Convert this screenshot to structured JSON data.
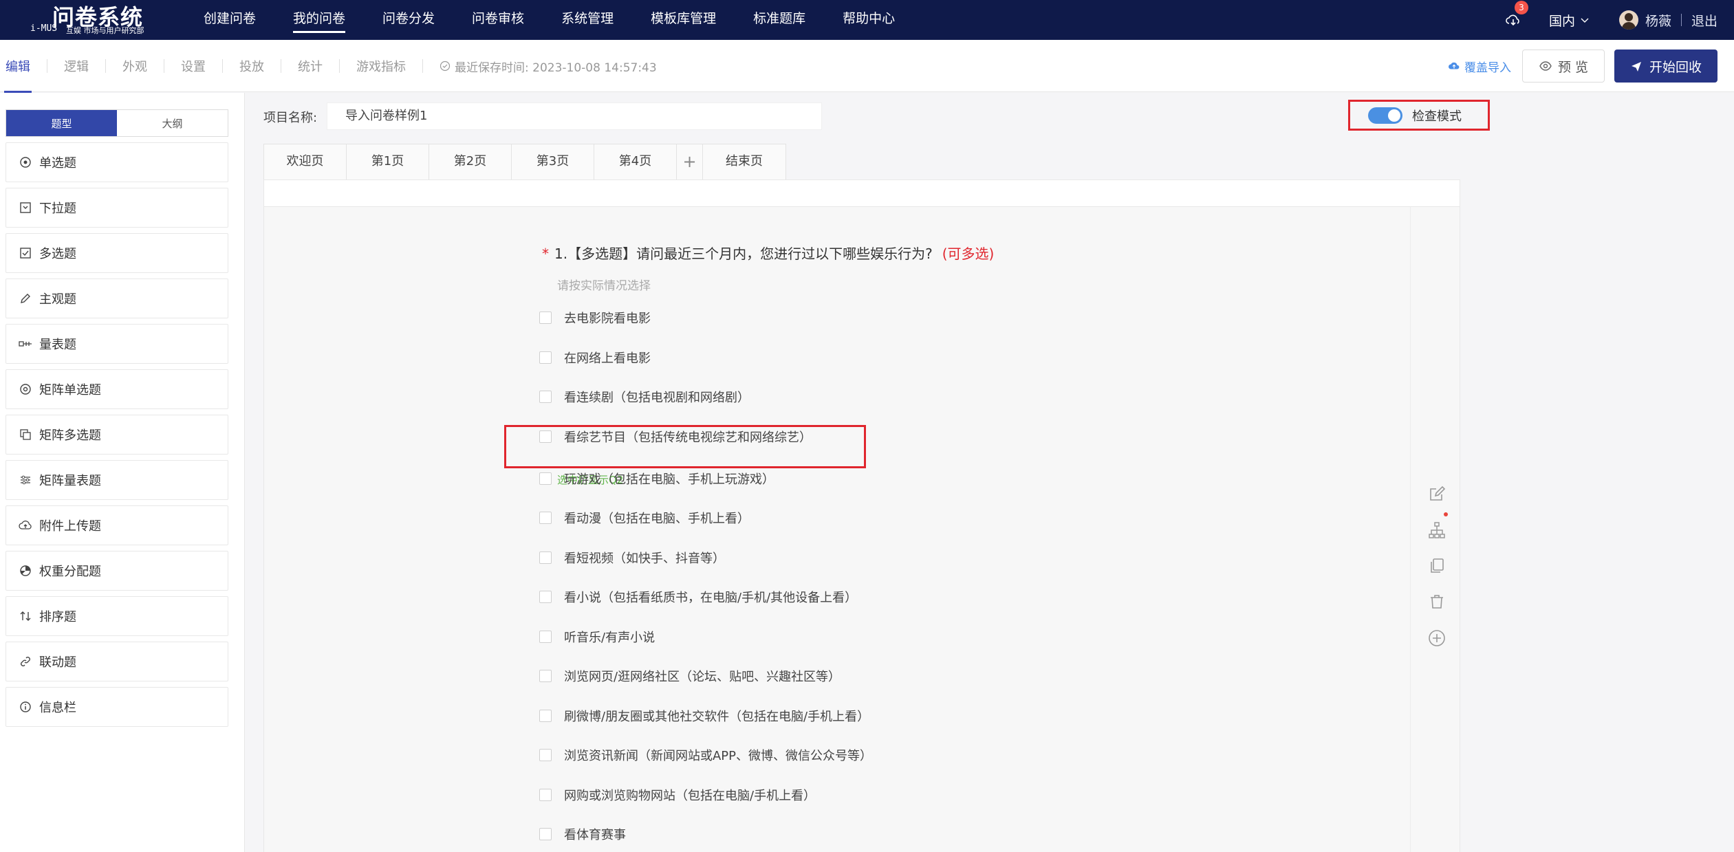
{
  "topnav": {
    "logo_title": "问卷系统",
    "logo_mark": "i-MUS",
    "logo_sub": "互娱 市场与用户研究部",
    "items": [
      {
        "label": "创建问卷"
      },
      {
        "label": "我的问卷",
        "active": true
      },
      {
        "label": "问卷分发"
      },
      {
        "label": "问卷审核"
      },
      {
        "label": "系统管理"
      },
      {
        "label": "模板库管理"
      },
      {
        "label": "标准题库"
      },
      {
        "label": "帮助中心"
      }
    ],
    "badge_count": "3",
    "region": "国内",
    "username": "杨薇",
    "logout": "退出"
  },
  "toolbar": {
    "tabs": [
      "编辑",
      "逻辑",
      "外观",
      "设置",
      "投放",
      "统计",
      "游戏指标"
    ],
    "active_tab": "编辑",
    "save_info": "最近保存时间: 2023-10-08 14:57:43",
    "import_label": "覆盖导入",
    "preview_label": "预 览",
    "start_label": "开始回收"
  },
  "sidebar": {
    "segments": [
      "题型",
      "大纲"
    ],
    "active_segment": "题型",
    "question_types": [
      {
        "label": "单选题",
        "icon": "radio-icon"
      },
      {
        "label": "下拉题",
        "icon": "dropdown-icon"
      },
      {
        "label": "多选题",
        "icon": "checkbox-icon"
      },
      {
        "label": "主观题",
        "icon": "pencil-icon"
      },
      {
        "label": "量表题",
        "icon": "scale-icon"
      },
      {
        "label": "矩阵单选题",
        "icon": "matrix-radio-icon"
      },
      {
        "label": "矩阵多选题",
        "icon": "matrix-checkbox-icon"
      },
      {
        "label": "矩阵量表题",
        "icon": "sliders-icon"
      },
      {
        "label": "附件上传题",
        "icon": "upload-cloud-icon"
      },
      {
        "label": "权重分配题",
        "icon": "pie-icon"
      },
      {
        "label": "排序题",
        "icon": "sort-icon"
      },
      {
        "label": "联动题",
        "icon": "link-icon"
      },
      {
        "label": "信息栏",
        "icon": "info-icon"
      }
    ]
  },
  "main": {
    "project_label": "项目名称:",
    "project_name": "导入问卷样例1",
    "check_mode_label": "检查模式",
    "check_mode_on": true,
    "page_tabs": [
      "欢迎页",
      "第1页",
      "第2页",
      "第3页",
      "第4页",
      "+",
      "结束页"
    ],
    "question": {
      "required_mark": "*",
      "title": "1.【多选题】请问最近三个月内，您进行过以下哪些娱乐行为?",
      "multi_tag": "(可多选)",
      "hint": "请按实际情况选择",
      "options": [
        "去电影院看电影",
        "在网络上看电影",
        "看连续剧（包括电视剧和网络剧）",
        "看综艺节目（包括传统电视综艺和网络综艺）",
        "玩游戏（包括在电脑、手机上玩游戏）",
        "看动漫（包括在电脑、手机上看）",
        "看短视频（如快手、抖音等）",
        "看小说（包括看纸质书，在电脑/手机/其他设备上看）",
        "听音乐/有声小说",
        "浏览网页/逛网络社区（论坛、贴吧、兴趣社区等）",
        "刷微博/朋友圈或其他社交软件（包括在电脑/手机上看）",
        "浏览资讯新闻（新闻网站或APP、微博、微信公众号等）",
        "网购或浏览购物网站（包括在电脑/手机上看）",
        "看体育赛事"
      ],
      "option_note": "选中后显示Q2"
    },
    "tools": [
      "edit-icon",
      "logic-tree-icon",
      "copy-icon",
      "delete-icon",
      "add-circle-icon"
    ]
  },
  "colors": {
    "nav_bg": "#0f1a4a",
    "accent": "#3b4cb8",
    "primary_button": "#273585",
    "highlight_red": "#e0262e",
    "note_green": "#5fb548",
    "link_blue": "#4a8ee8"
  }
}
